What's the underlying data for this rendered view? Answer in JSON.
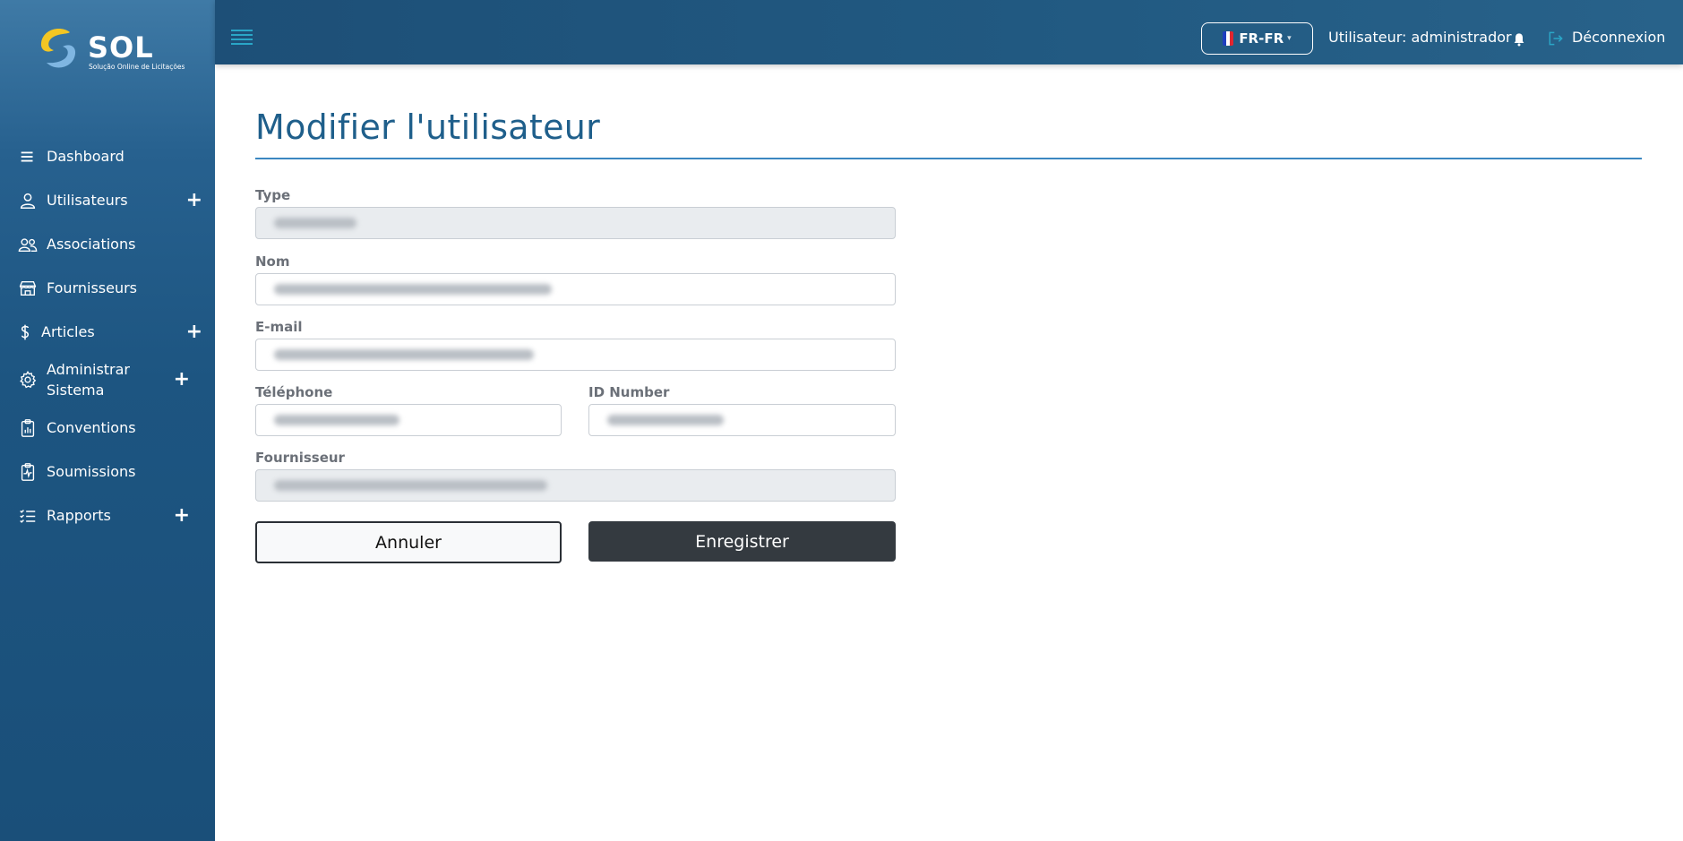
{
  "brand": {
    "name": "SOL",
    "tagline": "Solução Online de Licitações"
  },
  "sidebar": {
    "items": [
      {
        "label": "Dashboard",
        "icon": "menu-icon",
        "expandable": false
      },
      {
        "label": "Utilisateurs",
        "icon": "user-icon",
        "expandable": true
      },
      {
        "label": "Associations",
        "icon": "users-group-icon",
        "expandable": false
      },
      {
        "label": "Fournisseurs",
        "icon": "store-icon",
        "expandable": false
      },
      {
        "label": "Articles",
        "icon": "dollar-icon",
        "expandable": true
      },
      {
        "label": "Administrar Sistema",
        "icon": "gear-icon",
        "expandable": true
      },
      {
        "label": "Conventions",
        "icon": "clipboard-chart-icon",
        "expandable": false
      },
      {
        "label": "Soumissions",
        "icon": "clipboard-pulse-icon",
        "expandable": false
      },
      {
        "label": "Rapports",
        "icon": "list-check-icon",
        "expandable": true
      }
    ],
    "plus_symbol": "+"
  },
  "topbar": {
    "language": "FR-FR",
    "user_text": "Utilisateur: administrador",
    "logout_label": "Déconnexion"
  },
  "form": {
    "title": "Modifier l'utilisateur",
    "type_label": "Type",
    "name_label": "Nom",
    "email_label": "E-mail",
    "phone_label": "Téléphone",
    "id_label": "ID Number",
    "supplier_label": "Fournisseur",
    "cancel_label": "Annuler",
    "save_label": "Enregistrer"
  },
  "colors": {
    "sidebar": "#1d5581",
    "topbar": "#215981",
    "title": "#1f5f8b",
    "save_button": "#343a40"
  }
}
